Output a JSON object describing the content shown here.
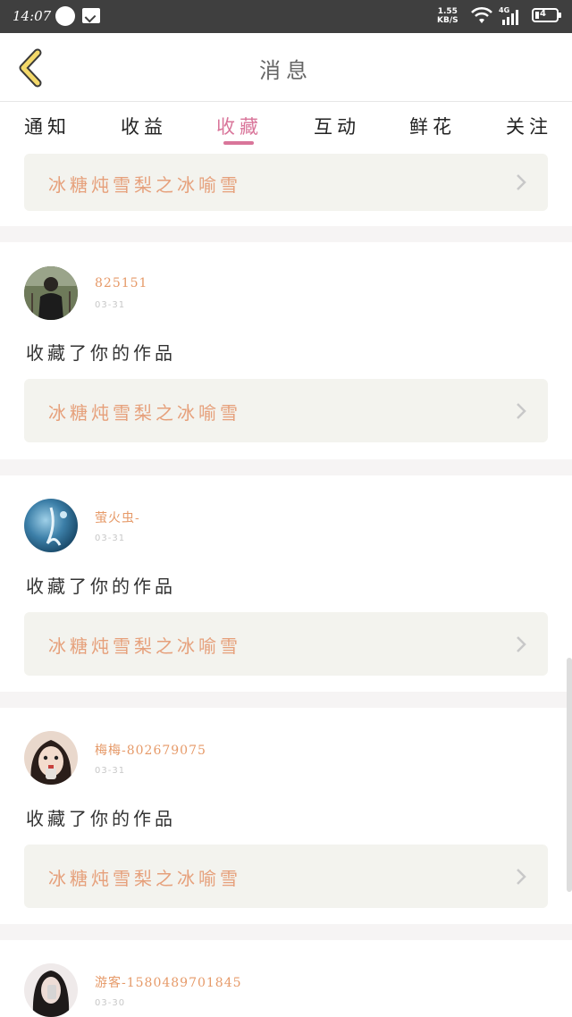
{
  "status_bar": {
    "time": "14:07",
    "speed_value": "1.55",
    "speed_unit": "KB/S",
    "network": "4G",
    "battery": "4"
  },
  "header": {
    "title": "消息"
  },
  "tabs": [
    {
      "label": "通知",
      "active": false
    },
    {
      "label": "收益",
      "active": false
    },
    {
      "label": "收藏",
      "active": true
    },
    {
      "label": "互动",
      "active": false
    },
    {
      "label": "鲜花",
      "active": false
    },
    {
      "label": "关注",
      "active": false
    }
  ],
  "top_partial_card": {
    "work_title": "冰糖炖雪梨之冰喻雪"
  },
  "items": [
    {
      "username": "825151",
      "date": "03-31",
      "action": "收藏了你的作品",
      "work_title": "冰糖炖雪梨之冰喻雪"
    },
    {
      "username": "萤火虫-",
      "date": "03-31",
      "action": "收藏了你的作品",
      "work_title": "冰糖炖雪梨之冰喻雪"
    },
    {
      "username": "梅梅-802679075",
      "date": "03-31",
      "action": "收藏了你的作品",
      "work_title": "冰糖炖雪梨之冰喻雪"
    },
    {
      "username": "游客-1580489701845",
      "date": "03-30"
    }
  ],
  "colors": {
    "accent": "#d9759a",
    "username": "#e69a69",
    "work_title": "#e6a07b",
    "card_bg": "#f3f3ee",
    "status_bar": "#3f3f3f"
  }
}
